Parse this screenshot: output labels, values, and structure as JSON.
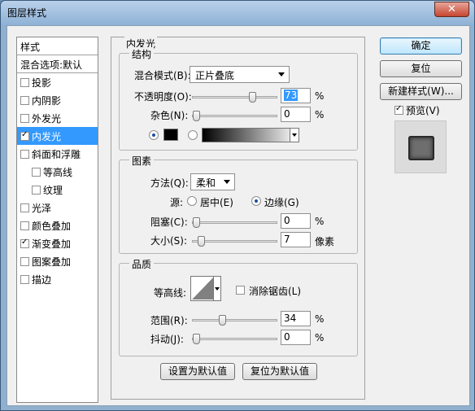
{
  "window": {
    "title": "图层样式"
  },
  "style_list": {
    "header": "样式",
    "blend_options": "混合选项:默认",
    "items": [
      {
        "label": "投影",
        "checked": false,
        "indent": false,
        "selected": false
      },
      {
        "label": "内阴影",
        "checked": false,
        "indent": false,
        "selected": false
      },
      {
        "label": "外发光",
        "checked": false,
        "indent": false,
        "selected": false
      },
      {
        "label": "内发光",
        "checked": true,
        "indent": false,
        "selected": true
      },
      {
        "label": "斜面和浮雕",
        "checked": false,
        "indent": false,
        "selected": false
      },
      {
        "label": "等高线",
        "checked": false,
        "indent": true,
        "selected": false
      },
      {
        "label": "纹理",
        "checked": false,
        "indent": true,
        "selected": false
      },
      {
        "label": "光泽",
        "checked": false,
        "indent": false,
        "selected": false
      },
      {
        "label": "颜色叠加",
        "checked": false,
        "indent": false,
        "selected": false
      },
      {
        "label": "渐变叠加",
        "checked": true,
        "indent": false,
        "selected": false
      },
      {
        "label": "图案叠加",
        "checked": false,
        "indent": false,
        "selected": false
      },
      {
        "label": "描边",
        "checked": false,
        "indent": false,
        "selected": false
      }
    ]
  },
  "panel": {
    "title": "内发光",
    "structure": {
      "title": "结构",
      "blend_mode_label": "混合模式(B):",
      "blend_mode_value": "正片叠底",
      "opacity_label": "不透明度(O):",
      "opacity_value": "73",
      "opacity_fraction": 0.73,
      "noise_label": "杂色(N):",
      "noise_value": "0",
      "noise_fraction": 0,
      "percent": "%"
    },
    "elements": {
      "title": "图素",
      "method_label": "方法(Q):",
      "method_value": "柔和",
      "source_label": "源:",
      "source_center": "居中(E)",
      "source_edge": "边缘(G)",
      "choke_label": "阻塞(C):",
      "choke_value": "0",
      "choke_fraction": 0,
      "size_label": "大小(S):",
      "size_value": "7",
      "size_unit": "像素",
      "percent": "%"
    },
    "quality": {
      "title": "品质",
      "contour_label": "等高线:",
      "antialias_label": "消除锯齿(L)",
      "range_label": "范围(R):",
      "range_value": "34",
      "range_fraction": 0.34,
      "jitter_label": "抖动(J):",
      "jitter_value": "0",
      "jitter_fraction": 0,
      "percent": "%"
    },
    "set_default": "设置为默认值",
    "reset_default": "复位为默认值"
  },
  "buttons": {
    "ok": "确定",
    "reset": "复位",
    "new_style": "新建样式(W)...",
    "preview_label": "预览(V)"
  },
  "icons": {
    "close": "close-icon"
  }
}
